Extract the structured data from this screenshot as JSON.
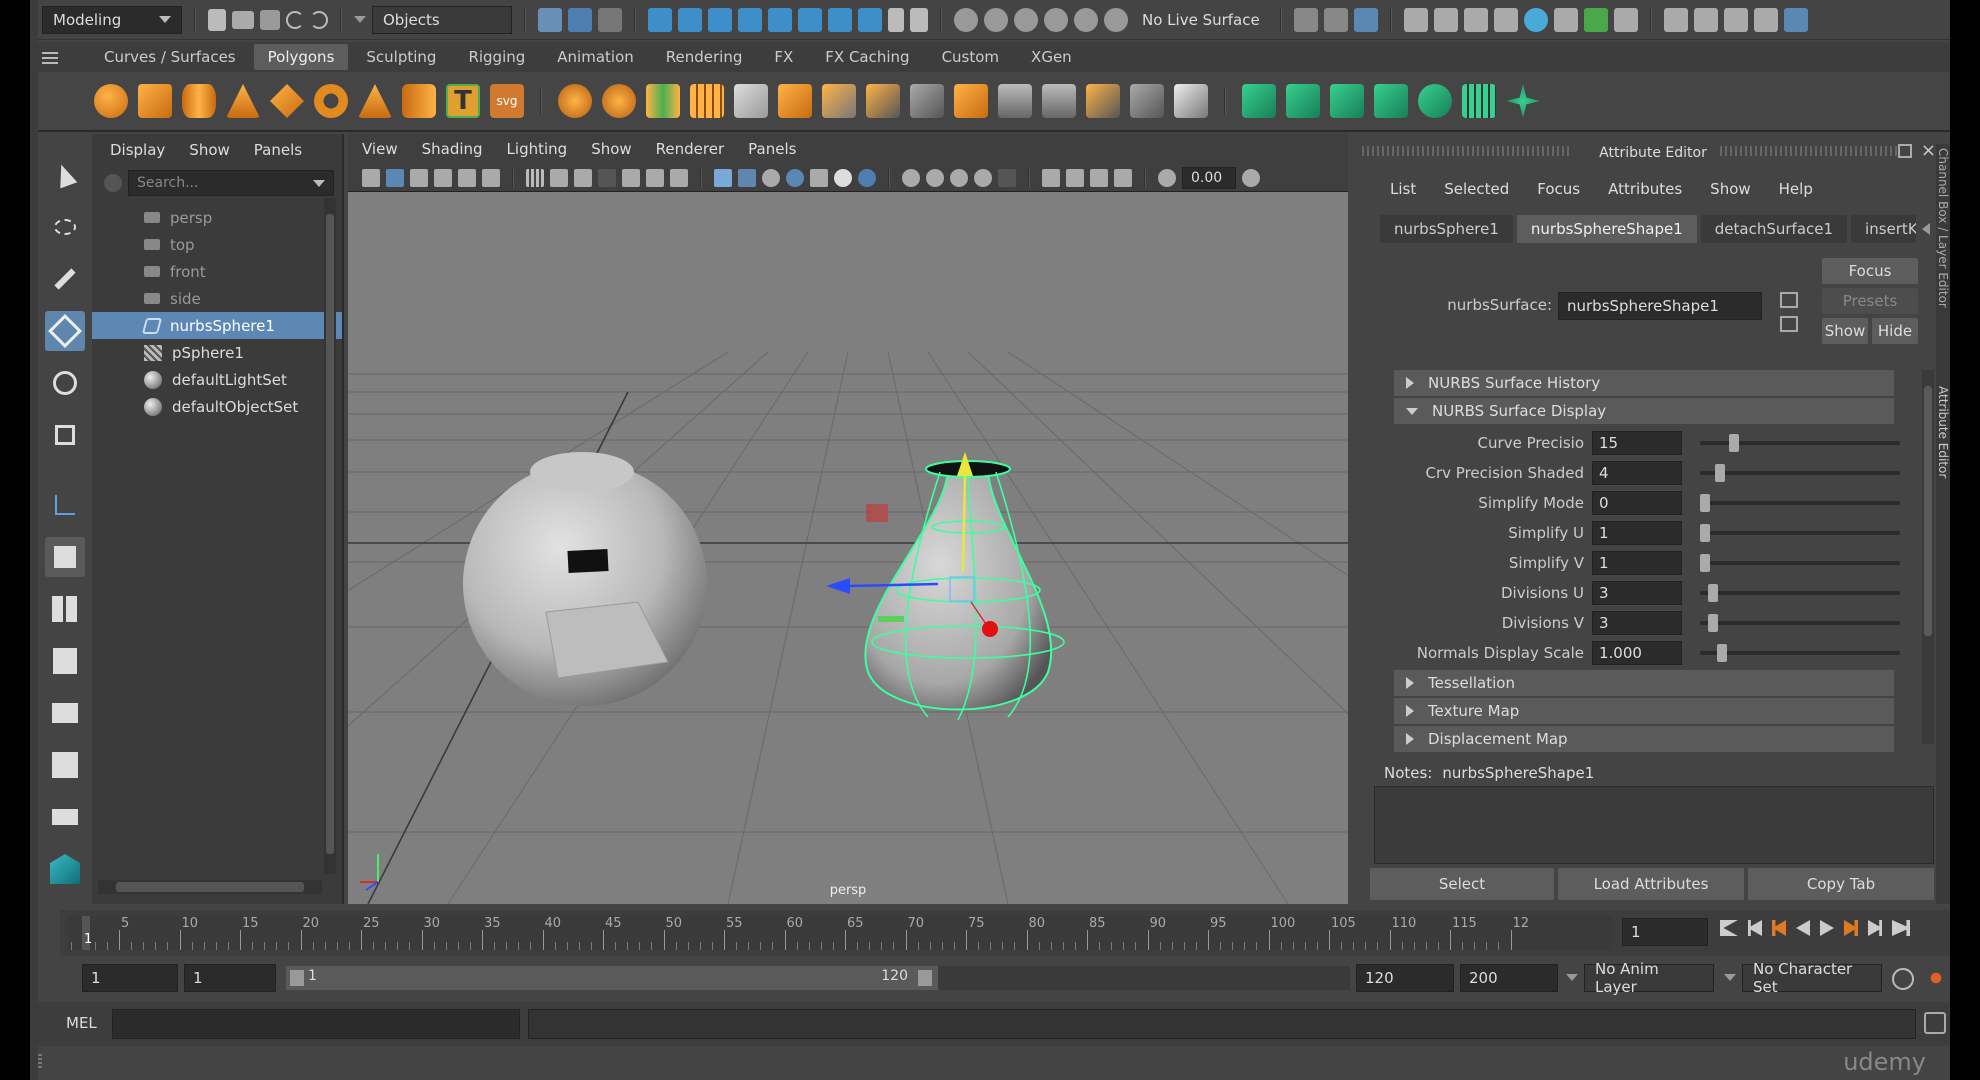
{
  "status_line": {
    "mode": "Modeling",
    "selection_mode": "Objects",
    "live_surface": "No Live Surface"
  },
  "shelf": {
    "tabs": [
      "Curves / Surfaces",
      "Polygons",
      "Sculpting",
      "Rigging",
      "Animation",
      "Rendering",
      "FX",
      "FX Caching",
      "Custom",
      "XGen"
    ],
    "active_tab": "Polygons"
  },
  "outliner": {
    "menu": [
      "Display",
      "Show",
      "Panels"
    ],
    "search_placeholder": "Search...",
    "items": [
      {
        "label": "persp",
        "type": "camera"
      },
      {
        "label": "top",
        "type": "camera"
      },
      {
        "label": "front",
        "type": "camera"
      },
      {
        "label": "side",
        "type": "camera"
      },
      {
        "label": "nurbsSphere1",
        "type": "nurbs",
        "selected": true
      },
      {
        "label": "pSphere1",
        "type": "poly"
      },
      {
        "label": "defaultLightSet",
        "type": "set"
      },
      {
        "label": "defaultObjectSet",
        "type": "set"
      }
    ]
  },
  "viewport": {
    "menu": [
      "View",
      "Shading",
      "Lighting",
      "Show",
      "Renderer",
      "Panels"
    ],
    "exposure": "0.00",
    "camera": "persp"
  },
  "attribute_editor": {
    "title": "Attribute Editor",
    "menu": [
      "List",
      "Selected",
      "Focus",
      "Attributes",
      "Show",
      "Help"
    ],
    "tabs": [
      "nurbsSphere1",
      "nurbsSphereShape1",
      "detachSurface1",
      "insertK"
    ],
    "active_tab": "nurbsSphereShape1",
    "node_label": "nurbsSurface:",
    "node_value": "nurbsSphereShape1",
    "focus_btn": "Focus",
    "presets_btn": "Presets",
    "show_btn": "Show",
    "hide_btn": "Hide",
    "sections_top": [
      {
        "label": "NURBS Surface History",
        "open": false
      },
      {
        "label": "NURBS Surface Display",
        "open": true
      }
    ],
    "attrs": [
      {
        "label": "Curve Precisio",
        "value": "15",
        "level": 0.15
      },
      {
        "label": "Crv Precision Shaded",
        "value": "4",
        "level": 0.08
      },
      {
        "label": "Simplify Mode",
        "value": "0",
        "level": 0.0
      },
      {
        "label": "Simplify U",
        "value": "1",
        "level": 0.0
      },
      {
        "label": "Simplify V",
        "value": "1",
        "level": 0.0
      },
      {
        "label": "Divisions U",
        "value": "3",
        "level": 0.04
      },
      {
        "label": "Divisions V",
        "value": "3",
        "level": 0.04
      },
      {
        "label": "Normals Display Scale",
        "value": "1.000",
        "level": 0.09
      }
    ],
    "sections_bottom": [
      {
        "label": "Tessellation"
      },
      {
        "label": "Texture Map"
      },
      {
        "label": "Displacement Map"
      }
    ],
    "notes_label": "Notes:",
    "notes_value": "nurbsSphereShape1",
    "buttons": [
      "Select",
      "Load Attributes",
      "Copy Tab"
    ],
    "side_tabs": [
      "Channel Box / Layer Editor",
      "Attribute Editor"
    ]
  },
  "timeline": {
    "ticks": [
      "5",
      "10",
      "15",
      "20",
      "25",
      "30",
      "35",
      "40",
      "45",
      "50",
      "55",
      "60",
      "65",
      "70",
      "75",
      "80",
      "85",
      "90",
      "95",
      "100",
      "105",
      "110",
      "115",
      "12"
    ],
    "current_frame_marker": "1",
    "current_frame": "1"
  },
  "range": {
    "start": "1",
    "playback_start": "1",
    "slider_start": "1",
    "slider_end": "120",
    "playback_end": "120",
    "end": "200",
    "anim_layer": "No Anim Layer",
    "character_set": "No Character Set"
  },
  "command_line": {
    "label": "MEL"
  },
  "watermark": "udemy"
}
